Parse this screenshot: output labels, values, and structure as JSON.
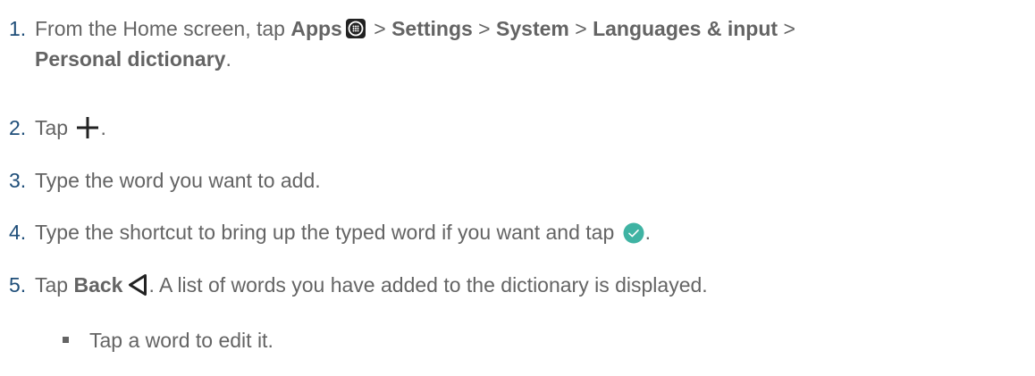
{
  "steps": [
    {
      "num": "1.",
      "t1": "From the Home screen, tap ",
      "apps": "Apps",
      "sep1": " > ",
      "settings": "Settings",
      "sep2": " > ",
      "system": "System",
      "sep3": " > ",
      "languages": "Languages & input",
      "sep4": " >",
      "personal": "Personal dictionary",
      "end": "."
    },
    {
      "num": "2.",
      "t1": "Tap ",
      "end": "."
    },
    {
      "num": "3.",
      "t1": "Type the word you want to add."
    },
    {
      "num": "4.",
      "t1": "Type the shortcut to bring up the typed word if you want and tap ",
      "end": "."
    },
    {
      "num": "5.",
      "t1": "Tap ",
      "back": "Back",
      "t2": ". A list of words you have added to the dictionary is displayed."
    }
  ],
  "sub": {
    "text": "Tap a word to edit it."
  },
  "icons": {
    "apps": "apps-grid-icon",
    "plus": "plus-icon",
    "check": "check-circle-icon",
    "back": "back-triangle-icon"
  },
  "colors": {
    "step_number": "#1f4e79",
    "body_text": "#646464",
    "check_circle": "#3fb3a3"
  }
}
